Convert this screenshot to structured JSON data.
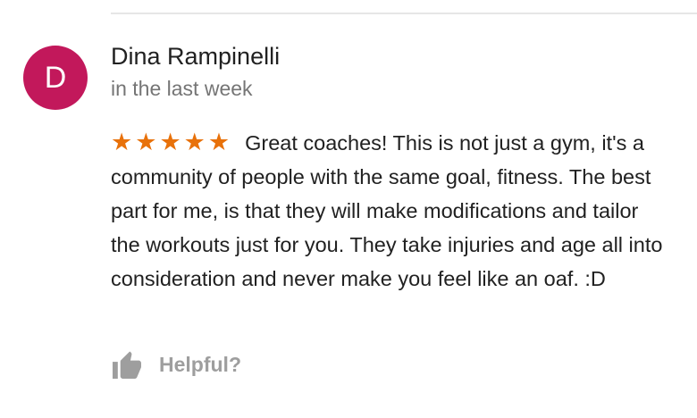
{
  "review": {
    "avatar_initial": "D",
    "author_name": "Dina Rampinelli",
    "date": "in the last week",
    "rating": 5,
    "text": "Great coaches!  This is not just a gym, it's a community of people with the same goal, fitness.  The best part for me, is that they will make modifications and tailor the workouts just for you.  They take injuries and age all into consideration and never make you feel like an oaf.  :D",
    "helpful_label": "Helpful?"
  },
  "colors": {
    "avatar_bg": "#c2185b",
    "star": "#e8710a",
    "helpful": "#9e9e9e"
  },
  "icons": {
    "star": "star-icon",
    "helpful": "thumbs-up-icon"
  }
}
